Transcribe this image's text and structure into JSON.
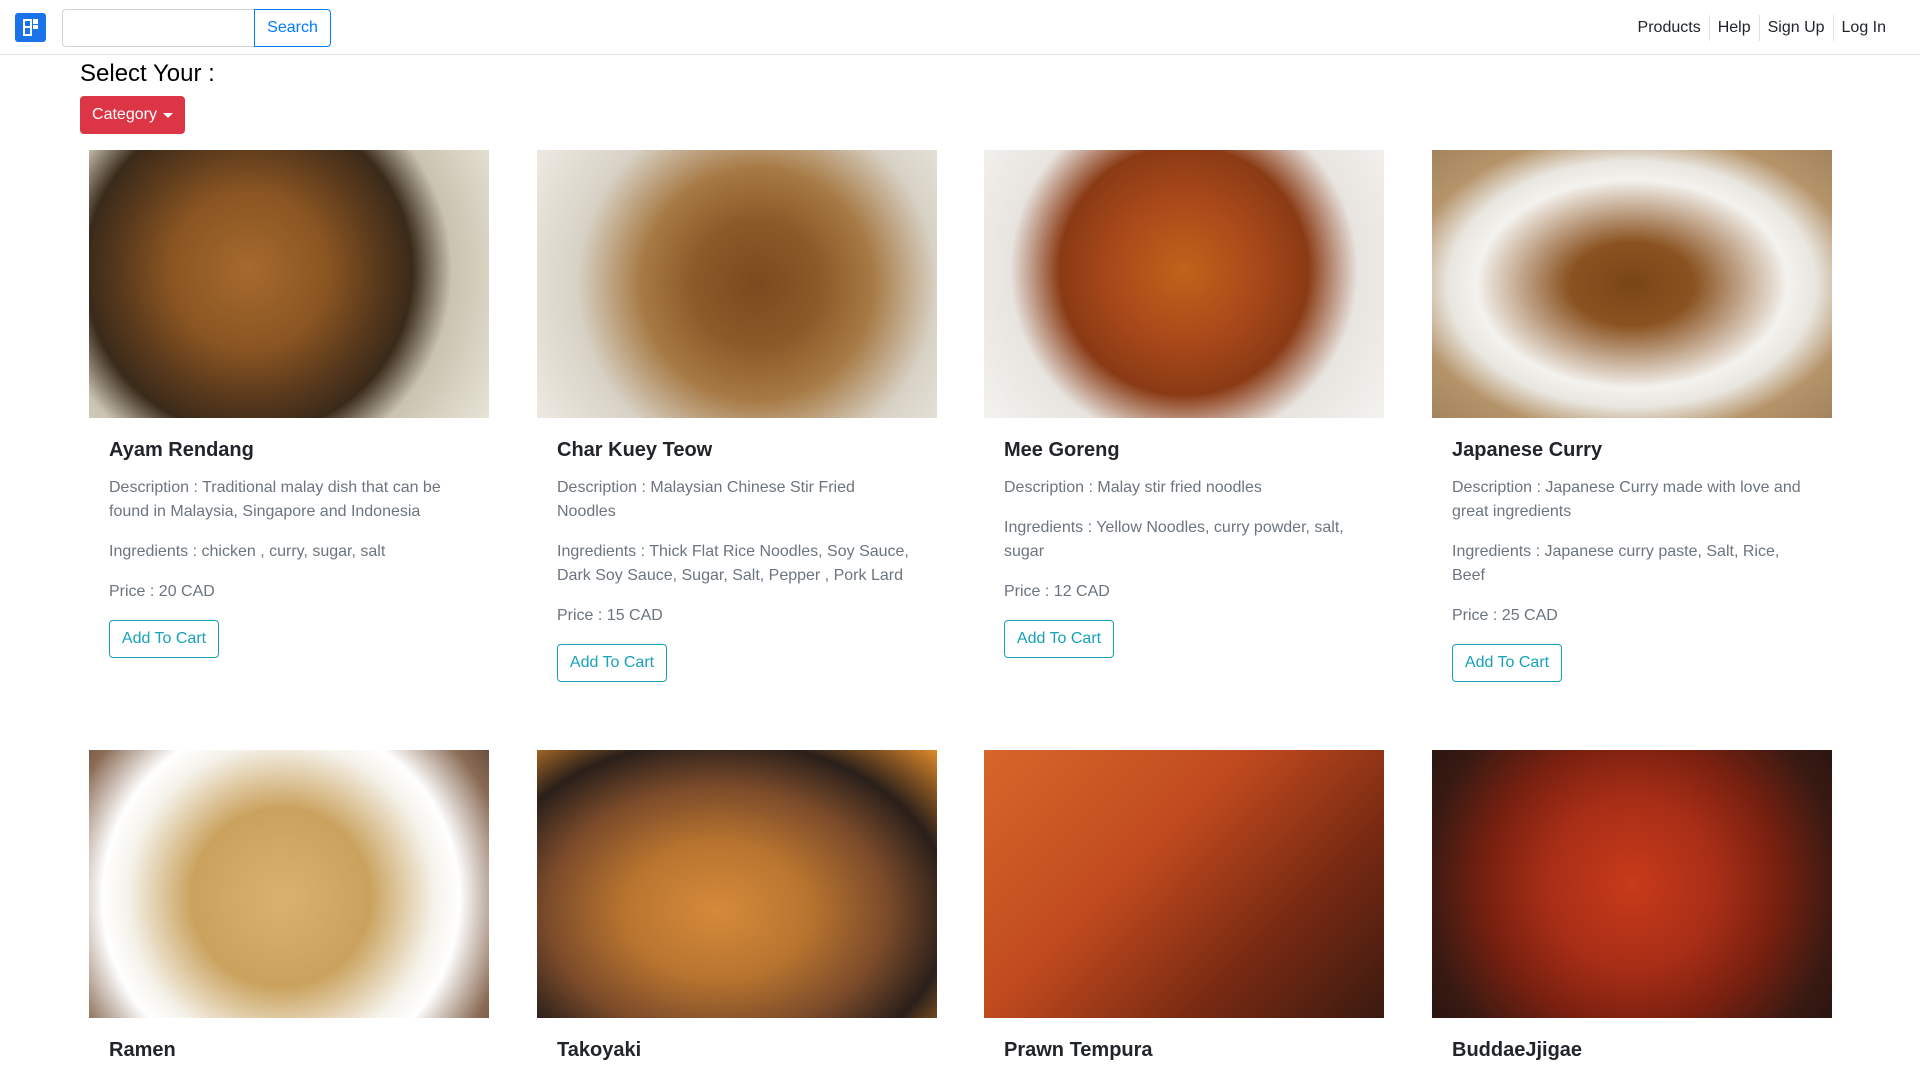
{
  "nav": {
    "brand_icon": "brand-logo-icon",
    "search": {
      "value": "",
      "placeholder": ""
    },
    "search_label": "Search",
    "links": [
      "Products",
      "Help",
      "Sign Up",
      "Log In"
    ]
  },
  "filter": {
    "title": "Select Your :",
    "category_label": "Category"
  },
  "products": [
    {
      "name": "Ayam Rendang",
      "description": "Description : Traditional malay dish that can be found in Malaysia, Singapore and Indonesia",
      "ingredients": "Ingredients : chicken , curry, sugar, salt",
      "price": "Price : 20 CAD",
      "button": "Add To Cart"
    },
    {
      "name": "Char Kuey Teow",
      "description": "Description : Malaysian Chinese Stir Fried Noodles",
      "ingredients": "Ingredients : Thick Flat Rice Noodles, Soy Sauce, Dark Soy Sauce, Sugar, Salt, Pepper , Pork Lard",
      "price": "Price : 15 CAD",
      "button": "Add To Cart"
    },
    {
      "name": "Mee Goreng",
      "description": "Description : Malay stir fried noodles",
      "ingredients": "Ingredients : Yellow Noodles, curry powder, salt, sugar",
      "price": "Price : 12 CAD",
      "button": "Add To Cart"
    },
    {
      "name": "Japanese Curry",
      "description": "Description : Japanese Curry made with love and great ingredients",
      "ingredients": "Ingredients : Japanese curry paste, Salt, Rice, Beef",
      "price": "Price : 25 CAD",
      "button": "Add To Cart"
    },
    {
      "name": "Ramen"
    },
    {
      "name": "Takoyaki"
    },
    {
      "name": "Prawn Tempura"
    },
    {
      "name": "BuddaeJjigae"
    }
  ],
  "colors": {
    "primary": "#007bff",
    "danger": "#dc3545",
    "info": "#17a2b8",
    "muted": "#6c757d"
  }
}
